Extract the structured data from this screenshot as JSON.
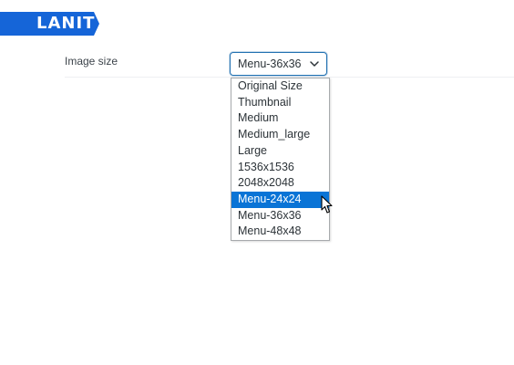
{
  "brand": {
    "logo_text": "LANIT",
    "color": "#1565d8"
  },
  "settings": {
    "image_size_label": "Image size",
    "image_size_value": "Menu-36x36",
    "options": [
      "Original Size",
      "Thumbnail",
      "Medium",
      "Medium_large",
      "Large",
      "1536x1536",
      "2048x2048",
      "Menu-24x24",
      "Menu-36x36",
      "Menu-48x48"
    ],
    "highlighted_option": "Menu-24x24"
  },
  "colors": {
    "accent": "#2271b1",
    "highlight": "#0a74d6"
  },
  "icons": {
    "select": "chevron-down-icon",
    "pointer": "mouse-cursor-icon"
  }
}
